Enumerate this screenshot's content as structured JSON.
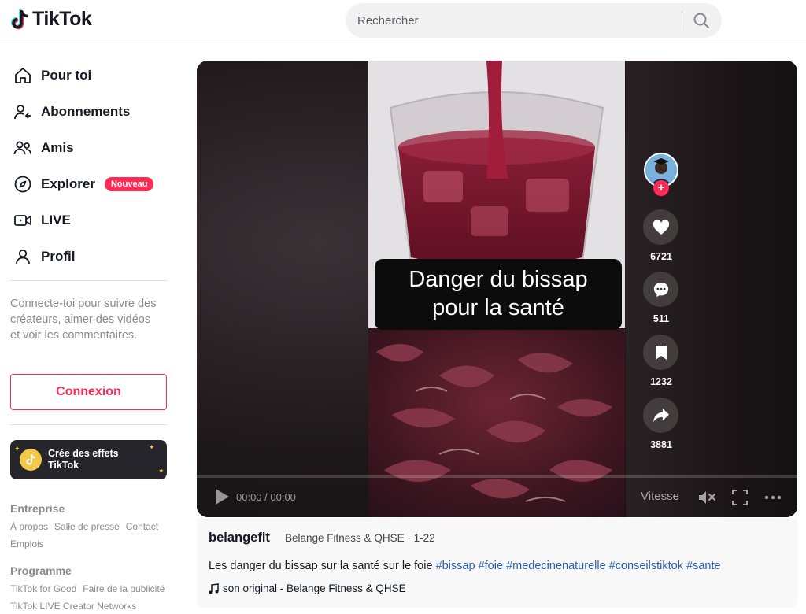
{
  "header": {
    "logo_text": "TikTok",
    "search_placeholder": "Rechercher"
  },
  "sidebar": {
    "nav": [
      {
        "label": "Pour toi",
        "icon": "home-icon"
      },
      {
        "label": "Abonnements",
        "icon": "following-icon"
      },
      {
        "label": "Amis",
        "icon": "friends-icon"
      },
      {
        "label": "Explorer",
        "icon": "compass-icon",
        "badge": "Nouveau"
      },
      {
        "label": "LIVE",
        "icon": "live-camera-icon"
      },
      {
        "label": "Profil",
        "icon": "profile-icon"
      }
    ],
    "login_hint": "Connecte-toi pour suivre des créateurs, aimer des vidéos et voir les commentaires.",
    "login_button": "Connexion",
    "effects_banner": {
      "line1": "Crée des effets",
      "line2": "TikTok"
    },
    "footer": {
      "section1_title": "Entreprise",
      "section1_links": [
        "À propos",
        "Salle de presse",
        "Contact",
        "Emplois"
      ],
      "section2_title": "Programme",
      "section2_links": [
        "TikTok for Good",
        "Faire de la publicité",
        "TikTok LIVE Creator Networks"
      ]
    }
  },
  "video": {
    "overlay_line1": "Danger du bissap",
    "overlay_line2": "pour la santé",
    "likes": "6721",
    "comments": "511",
    "bookmarks": "1232",
    "shares": "3881",
    "time": "00:00 / 00:00",
    "speed_label": "Vitesse"
  },
  "post": {
    "username": "belangefit",
    "author_line": "Belange Fitness & QHSE · 1-22",
    "description": "Les danger du bissap sur la santé sur le foie ",
    "hashtags": [
      "#bissap",
      "#foie",
      "#medecinenaturelle",
      "#conseilstiktok",
      "#sante"
    ],
    "sound": "son original - Belange Fitness & QHSE"
  },
  "colors": {
    "brand": "#fe2c55",
    "hashtag": "#2b5db9",
    "text": "#161823",
    "muted": "#8a8b91"
  }
}
